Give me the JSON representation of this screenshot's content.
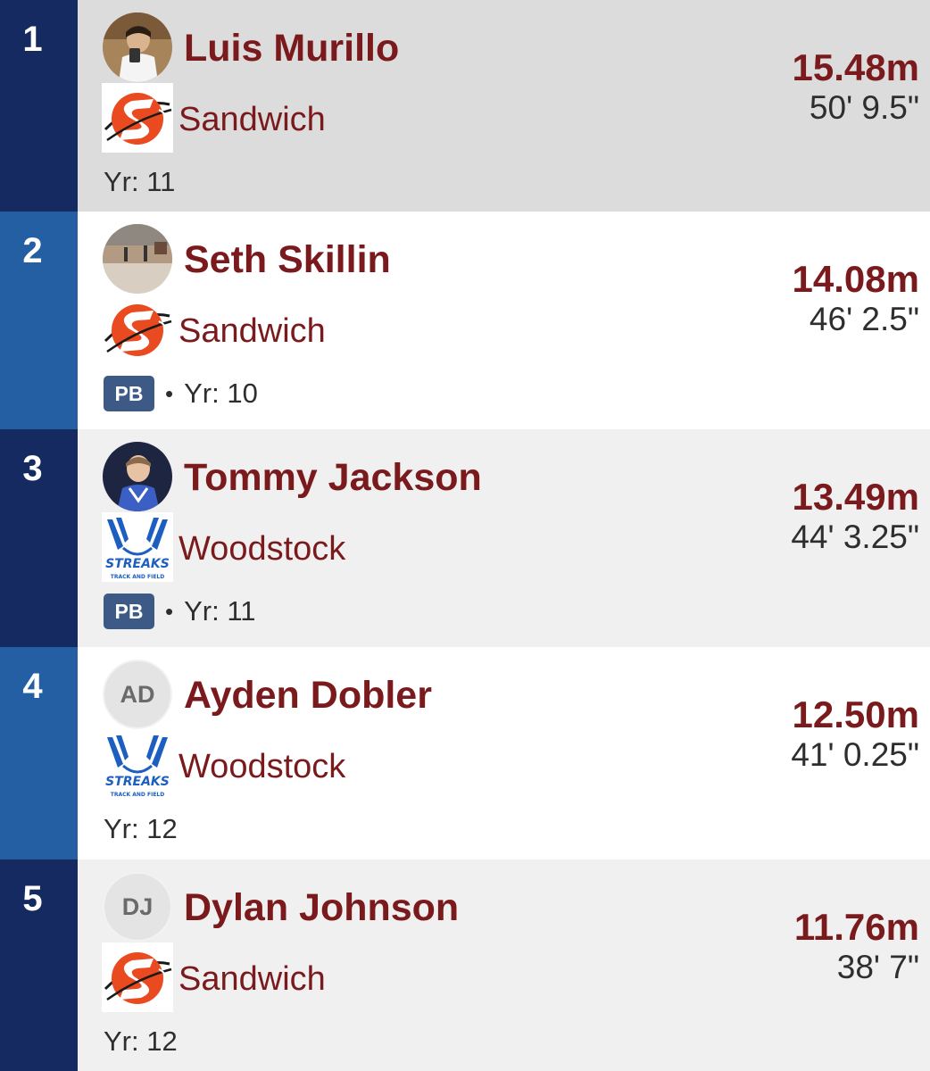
{
  "results": [
    {
      "rank": "1",
      "name": "Luis Murillo",
      "avatar": "photo",
      "team": "Sandwich",
      "team_logo": "sandwich-logo",
      "pb": "",
      "year": "Yr: 11",
      "mark": "15.48m",
      "imperial": "50' 9.5\""
    },
    {
      "rank": "2",
      "name": "Seth Skillin",
      "avatar": "photo",
      "team": "Sandwich",
      "team_logo": "sandwich-logo",
      "pb": "PB",
      "year": "Yr: 10",
      "mark": "14.08m",
      "imperial": "46' 2.5\""
    },
    {
      "rank": "3",
      "name": "Tommy Jackson",
      "avatar": "photo",
      "team": "Woodstock",
      "team_logo": "streaks-logo",
      "pb": "PB",
      "year": "Yr: 11",
      "mark": "13.49m",
      "imperial": "44' 3.25\""
    },
    {
      "rank": "4",
      "name": "Ayden Dobler",
      "avatar": "AD",
      "team": "Woodstock",
      "team_logo": "streaks-logo",
      "pb": "",
      "year": "Yr: 12",
      "mark": "12.50m",
      "imperial": "41' 0.25\""
    },
    {
      "rank": "5",
      "name": "Dylan Johnson",
      "avatar": "DJ",
      "team": "Sandwich",
      "team_logo": "sandwich-logo",
      "pb": "",
      "year": "Yr: 12",
      "mark": "11.76m",
      "imperial": "38' 7\""
    }
  ],
  "logo_text": {
    "streaks": "STREAKS",
    "streaks_sub": "TRACK AND FIELD"
  },
  "colors": {
    "rank_dark": "#152a60",
    "rank_mid": "#245ea3",
    "name": "#7a1a1c",
    "pb_badge": "#3d5a87"
  }
}
